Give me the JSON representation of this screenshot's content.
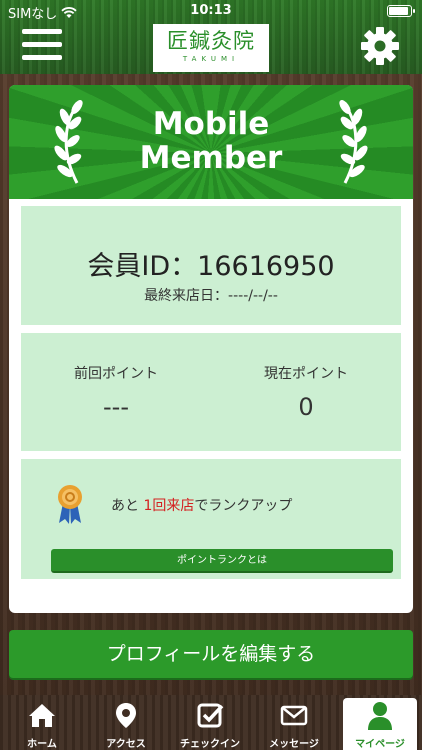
{
  "status_bar": {
    "carrier": "SIMなし",
    "time": "10:13"
  },
  "header": {
    "logo_kanji": "匠鍼灸院",
    "logo_sub": "TAKUMI"
  },
  "banner": {
    "title_line1": "Mobile",
    "title_line2": "Member"
  },
  "member": {
    "id_text": "会員ID：16616950",
    "last_visit": "最終来店日：----/--/--"
  },
  "points": {
    "previous_label": "前回ポイント",
    "previous_value": "---",
    "current_label": "現在ポイント",
    "current_value": "0"
  },
  "rank": {
    "prefix": "あと ",
    "highlight": "1回来店",
    "suffix": "でランクアップ",
    "button_label": "ポイントランクとは"
  },
  "edit_profile_label": "プロフィールを編集する",
  "tabs": [
    {
      "label": "ホーム",
      "icon": "home-icon"
    },
    {
      "label": "アクセス",
      "icon": "map-pin-icon"
    },
    {
      "label": "チェックイン",
      "icon": "checkin-icon"
    },
    {
      "label": "メッセージ",
      "icon": "mail-icon"
    },
    {
      "label": "マイページ",
      "icon": "user-icon",
      "active": true
    }
  ],
  "colors": {
    "accent": "#2c9a2a",
    "highlight": "#d42020",
    "panel": "#ccefd2"
  }
}
